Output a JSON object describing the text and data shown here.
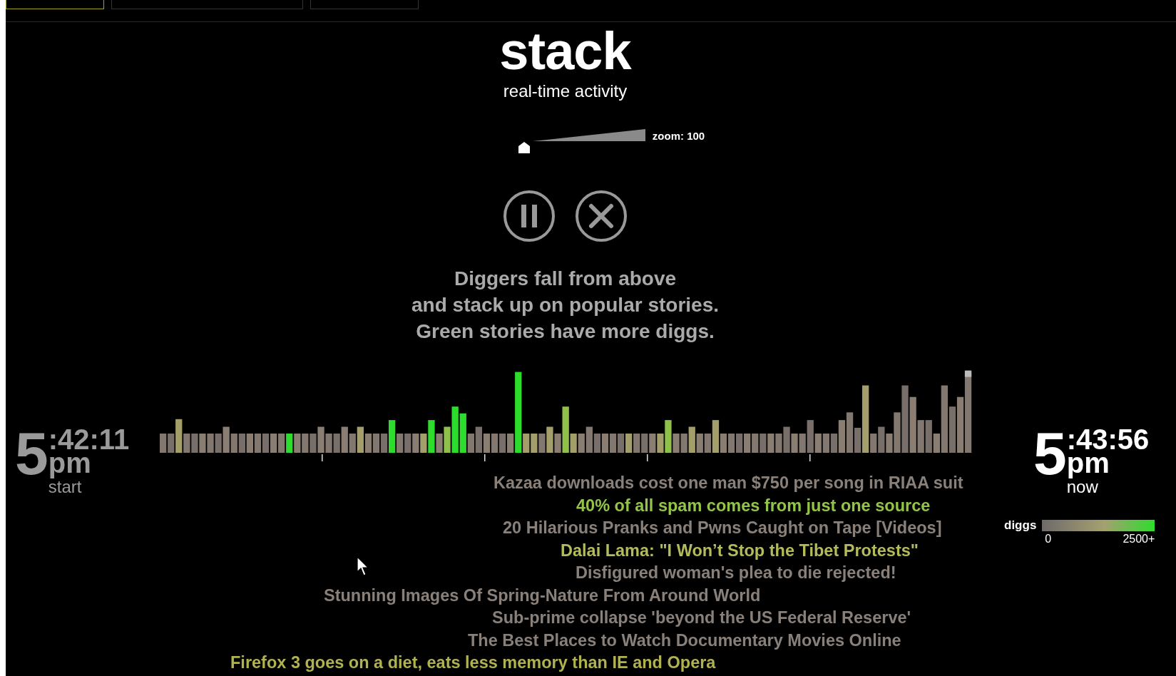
{
  "tabs": [
    {
      "selected": true
    },
    {
      "selected": false
    },
    {
      "selected": false
    }
  ],
  "title": "stack",
  "subtitle": "real-time activity",
  "zoom": {
    "label": "zoom: 100",
    "level": 0
  },
  "controls": [
    {
      "kind": "pause"
    },
    {
      "kind": "close"
    }
  ],
  "instructions": [
    "Diggers fall from above",
    "and stack up on popular stories.",
    "Green stories have more diggs."
  ],
  "start_time": {
    "hour": "5",
    "rest": ":42:11",
    "ampm": "pm",
    "label": "start"
  },
  "now_time": {
    "hour": "5",
    "rest": ":43:56",
    "ampm": "pm",
    "label": "now"
  },
  "legend": {
    "label": "diggs",
    "min": "0",
    "max": "2500+"
  },
  "stories": [
    {
      "text": "Kazaa downloads cost one man $750 per song in RIAA suit",
      "color": "#8a807a"
    },
    {
      "text": "40% of all spam comes from just one source",
      "color": "#93c447"
    },
    {
      "text": "20 Hilarious Pranks and Pwns Caught on Tape [Videos]",
      "color": "#8a807a"
    },
    {
      "text": "Dalai Lama: \"I Won’t Stop the Tibet Protests\"",
      "color": "#b3bb5a"
    },
    {
      "text": "Disfigured woman's plea to die rejected!",
      "color": "#8a807a"
    },
    {
      "text": "Stunning Images Of Spring-Nature From Around World",
      "color": "#8a807a"
    },
    {
      "text": "Sub-prime collapse 'beyond the US Federal Reserve'",
      "color": "#8a807a"
    },
    {
      "text": "The Best Places to Watch Documentary Movies Online",
      "color": "#8a807a"
    },
    {
      "text": "Firefox 3 goes on a diet, eats less memory than IE and Opera",
      "color": "#b0b24e"
    }
  ]
}
